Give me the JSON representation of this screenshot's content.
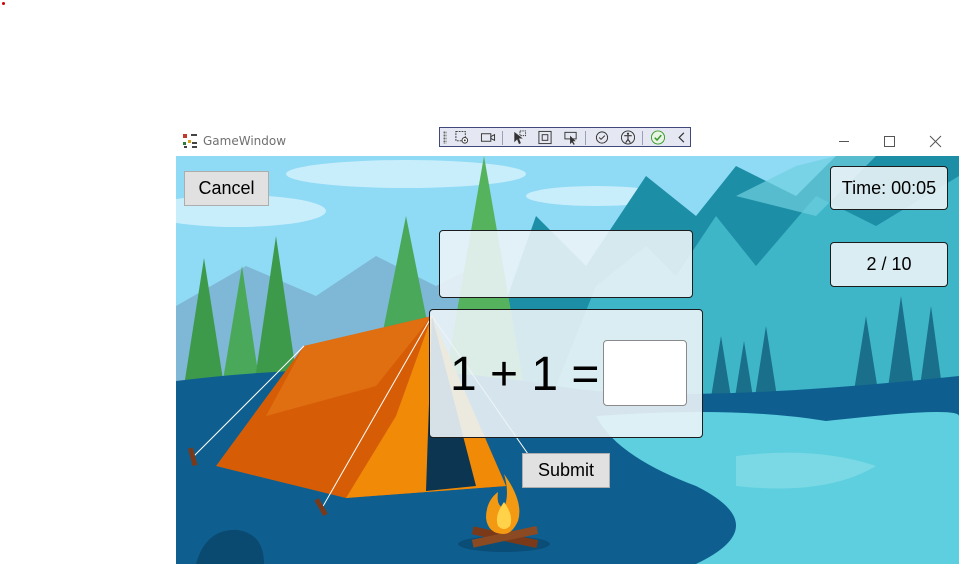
{
  "window": {
    "title": "GameWindow",
    "app_icon": "visual-studio-app-icon",
    "controls": {
      "minimize_icon": "minimize-icon",
      "maximize_icon": "maximize-icon",
      "close_icon": "close-icon"
    }
  },
  "debug_toolbar": {
    "icons": [
      "grip-icon",
      "select-element-icon",
      "record-icon",
      "select-cursor-icon",
      "display-layout-adorners-icon",
      "track-focus-icon",
      "binding-failures-icon",
      "accessibility-icon",
      "check-icon",
      "collapse-chevron-icon"
    ]
  },
  "game": {
    "cancel_label": "Cancel",
    "timer_text": "Time:  00:05",
    "progress_text": "2  /  10",
    "message_text": "",
    "question_text": "1 + 1 =",
    "answer_value": "",
    "submit_label": "Submit"
  },
  "colors": {
    "sky": "#8fdaf5",
    "mountains": "#1c8ea6",
    "tent": "#d65d06",
    "ground": "#0e5f8f",
    "lake": "#5ecfdf",
    "button_bg": "#e1e1e1",
    "panel_bg": "#ebf3f7"
  }
}
